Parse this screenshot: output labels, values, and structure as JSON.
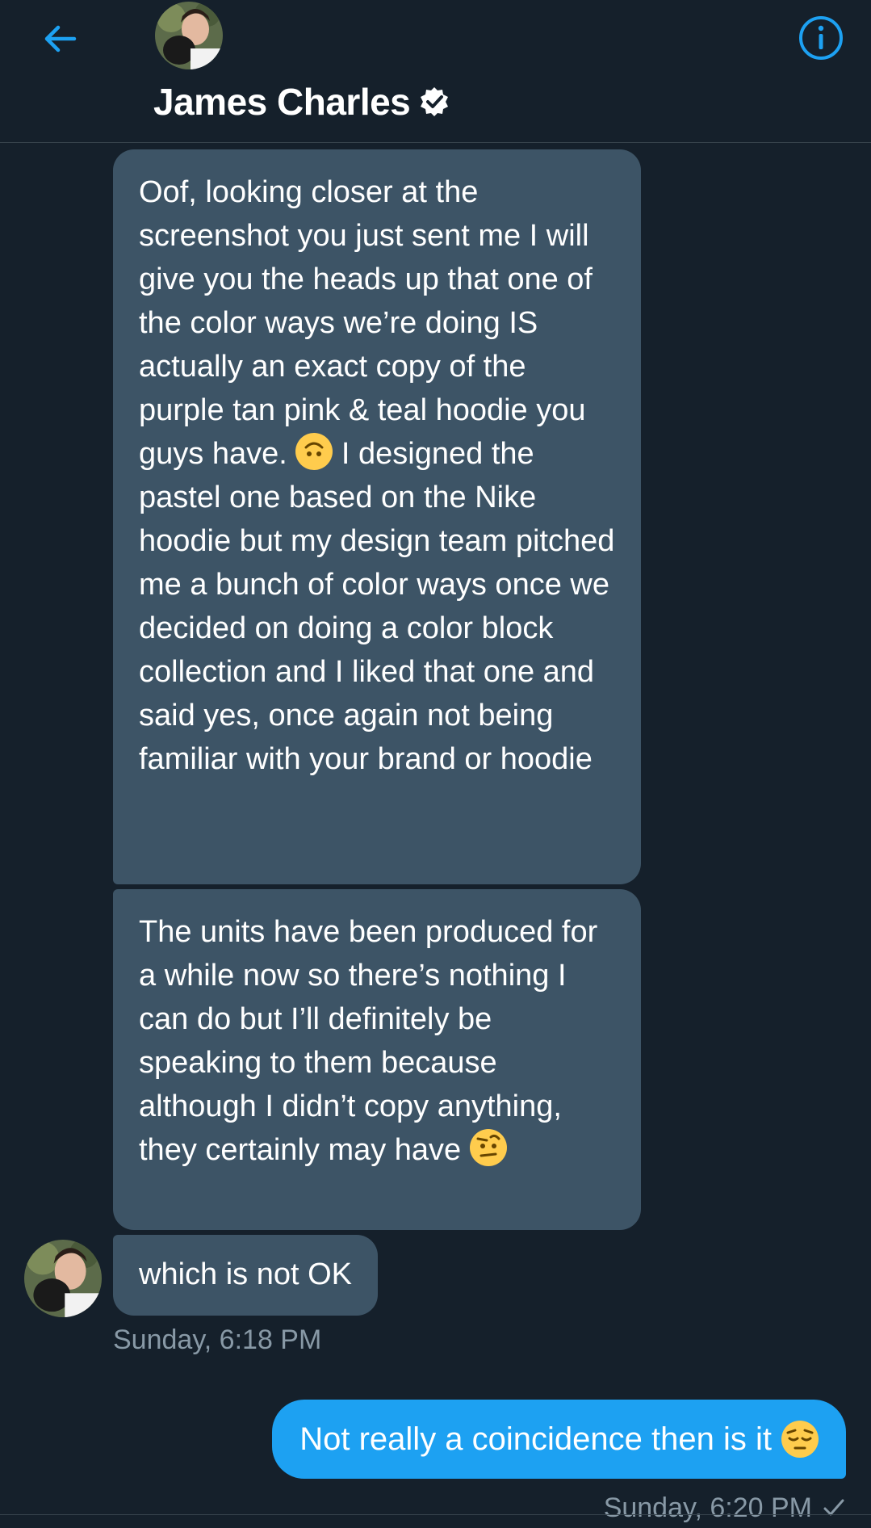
{
  "header": {
    "back_icon": "arrow-left-icon",
    "info_icon": "info-circle-icon",
    "contact_name": "James Charles",
    "verified_icon": "verified-badge-icon",
    "accent_color": "#1da1f2"
  },
  "messages": {
    "incoming_1": {
      "part1": "Oof, looking closer at the screenshot you just sent me I will give you the heads up that one of the color ways we’re doing IS actually an exact copy of the purple tan pink & teal hoodie you guys have.",
      "emoji": "upside-down-face-emoji",
      "part2": "I designed the pastel one based on the Nike hoodie but my design team pitched me a bunch of color ways once we decided on doing a color block collection and I liked that one and said yes, once again not being familiar with your brand or hoodie"
    },
    "incoming_2": {
      "text": "The units have been produced for a while now so there’s nothing I can do but I’ll definitely be speaking to them because although I didn’t copy anything, they certainly may have",
      "emoji": "face-with-raised-eyebrow-emoji"
    },
    "incoming_3": {
      "text": "which is not OK"
    },
    "incoming_time": "Sunday, 6:18 PM",
    "outgoing_1": {
      "text": "Not really a coincidence then is it",
      "emoji": "pensive-face-emoji"
    },
    "outgoing_time": "Sunday, 6:20 PM",
    "sent_icon": "checkmark-icon"
  },
  "colors": {
    "background": "#15202b",
    "incoming_bubble": "#3d5466",
    "outgoing_bubble": "#1da1f2",
    "timestamp": "#8899a6"
  }
}
